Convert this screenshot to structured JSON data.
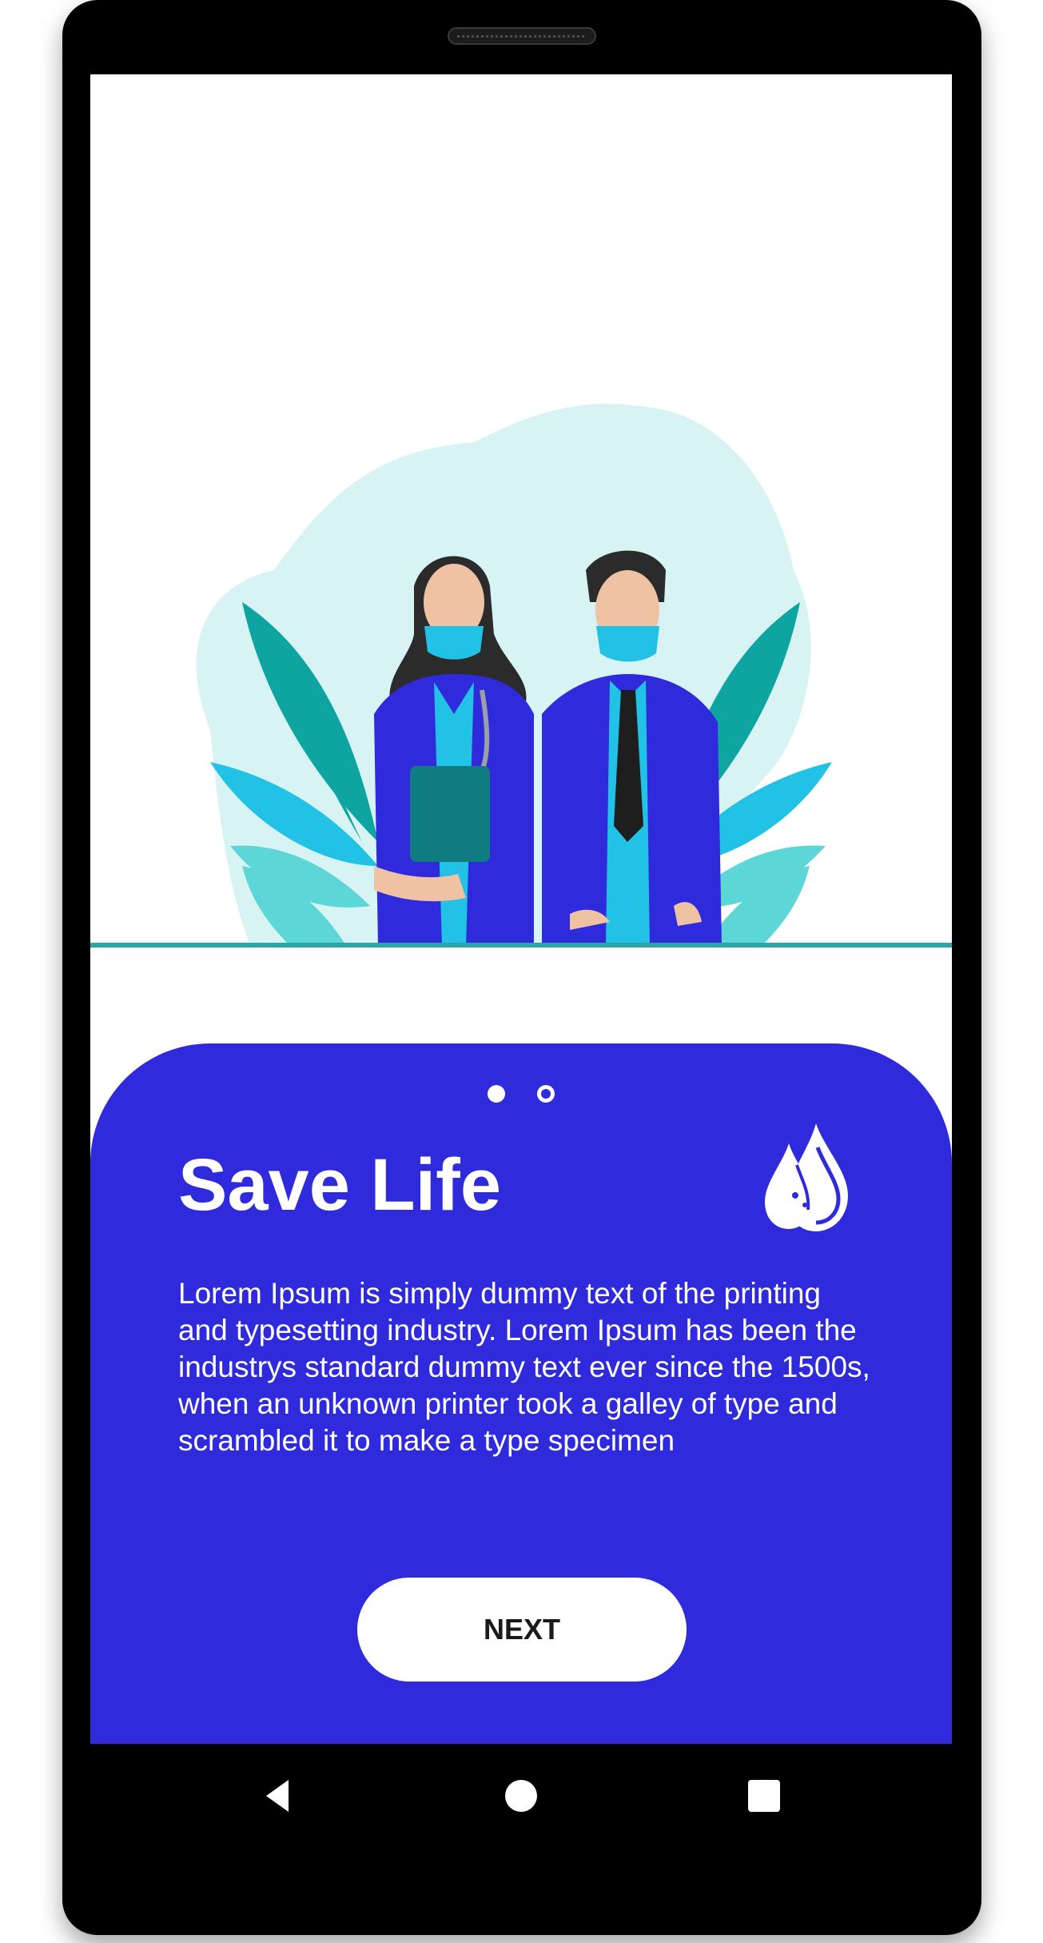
{
  "onboarding": {
    "title": "Save Life",
    "description": "Lorem Ipsum is simply dummy text of the printing and typesetting industry. Lorem Ipsum has been the industrys standard dummy text ever since the 1500s, when an unknown printer took a galley of type and scrambled it to make a type specimen",
    "next_label": "NEXT",
    "page_indicator": {
      "total": 2,
      "current": 1
    },
    "icon": "water-drops-icon",
    "illustration": "doctors-illustration"
  },
  "system_nav": {
    "back_icon": "back-triangle-icon",
    "home_icon": "home-circle-icon",
    "recents_icon": "recents-square-icon"
  },
  "colors": {
    "primary": "#2f2bdc",
    "button_background": "#ffffff",
    "button_text": "#1a1a1a",
    "accent_teal": "#0ea5a0",
    "accent_cyan": "#22c1e6"
  }
}
